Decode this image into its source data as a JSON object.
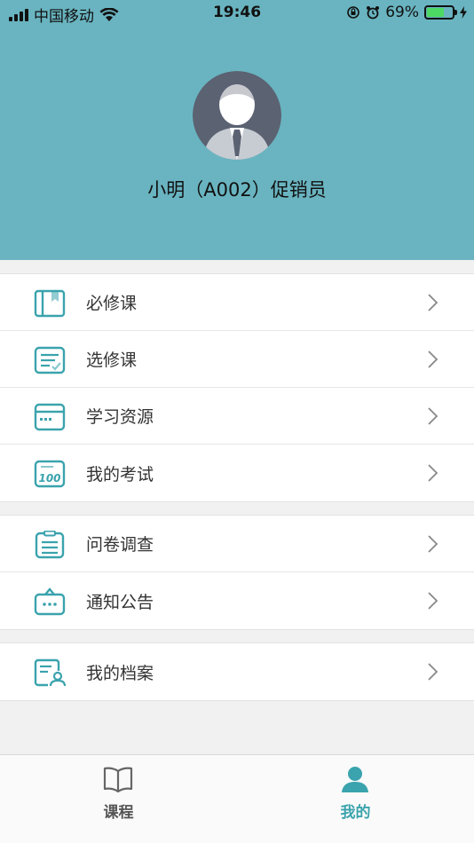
{
  "status_bar": {
    "carrier": "中国移动",
    "time": "19:46",
    "battery_percent": "69%",
    "battery_level": 0.69
  },
  "profile": {
    "name": "小明（A002）促销员"
  },
  "menu_groups": [
    [
      {
        "label": "必修课",
        "icon": "book-icon"
      },
      {
        "label": "选修课",
        "icon": "list-check-icon"
      },
      {
        "label": "学习资源",
        "icon": "window-icon"
      },
      {
        "label": "我的考试",
        "icon": "score-100-icon"
      }
    ],
    [
      {
        "label": "问卷调查",
        "icon": "clipboard-icon"
      },
      {
        "label": "通知公告",
        "icon": "message-icon"
      }
    ],
    [
      {
        "label": "我的档案",
        "icon": "profile-file-icon"
      }
    ]
  ],
  "tab_bar": {
    "courses_label": "课程",
    "mine_label": "我的",
    "active_color": "#3aa3ad",
    "inactive_color": "#555555"
  },
  "colors": {
    "header_bg": "#69b4c0",
    "icon_accent": "#3aa3ad"
  }
}
